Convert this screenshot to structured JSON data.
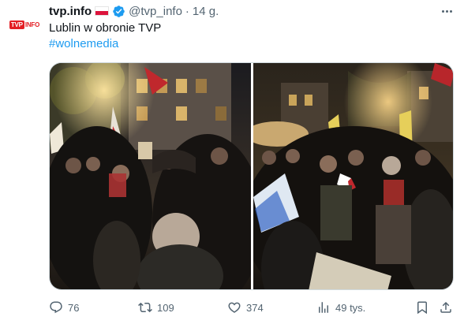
{
  "author": {
    "display_name": "tvp.info",
    "handle": "@tvp_info",
    "separator": "·",
    "time": "14 g.",
    "avatar_text_tvp": "TVP",
    "avatar_text_info": "INFO",
    "verified": true,
    "flag": "poland-flag"
  },
  "tweet": {
    "text": "Lublin w obronie TVP",
    "hashtag": "#wolnemedia"
  },
  "media": {
    "photo_count": 2
  },
  "actions": {
    "reply_count": "76",
    "retweet_count": "109",
    "like_count": "374",
    "views_count": "49 tys."
  },
  "colors": {
    "link": "#1d9bf0",
    "secondary_text": "#536471",
    "brand_red": "#e31e24",
    "verified_blue": "#1d9bf0"
  }
}
